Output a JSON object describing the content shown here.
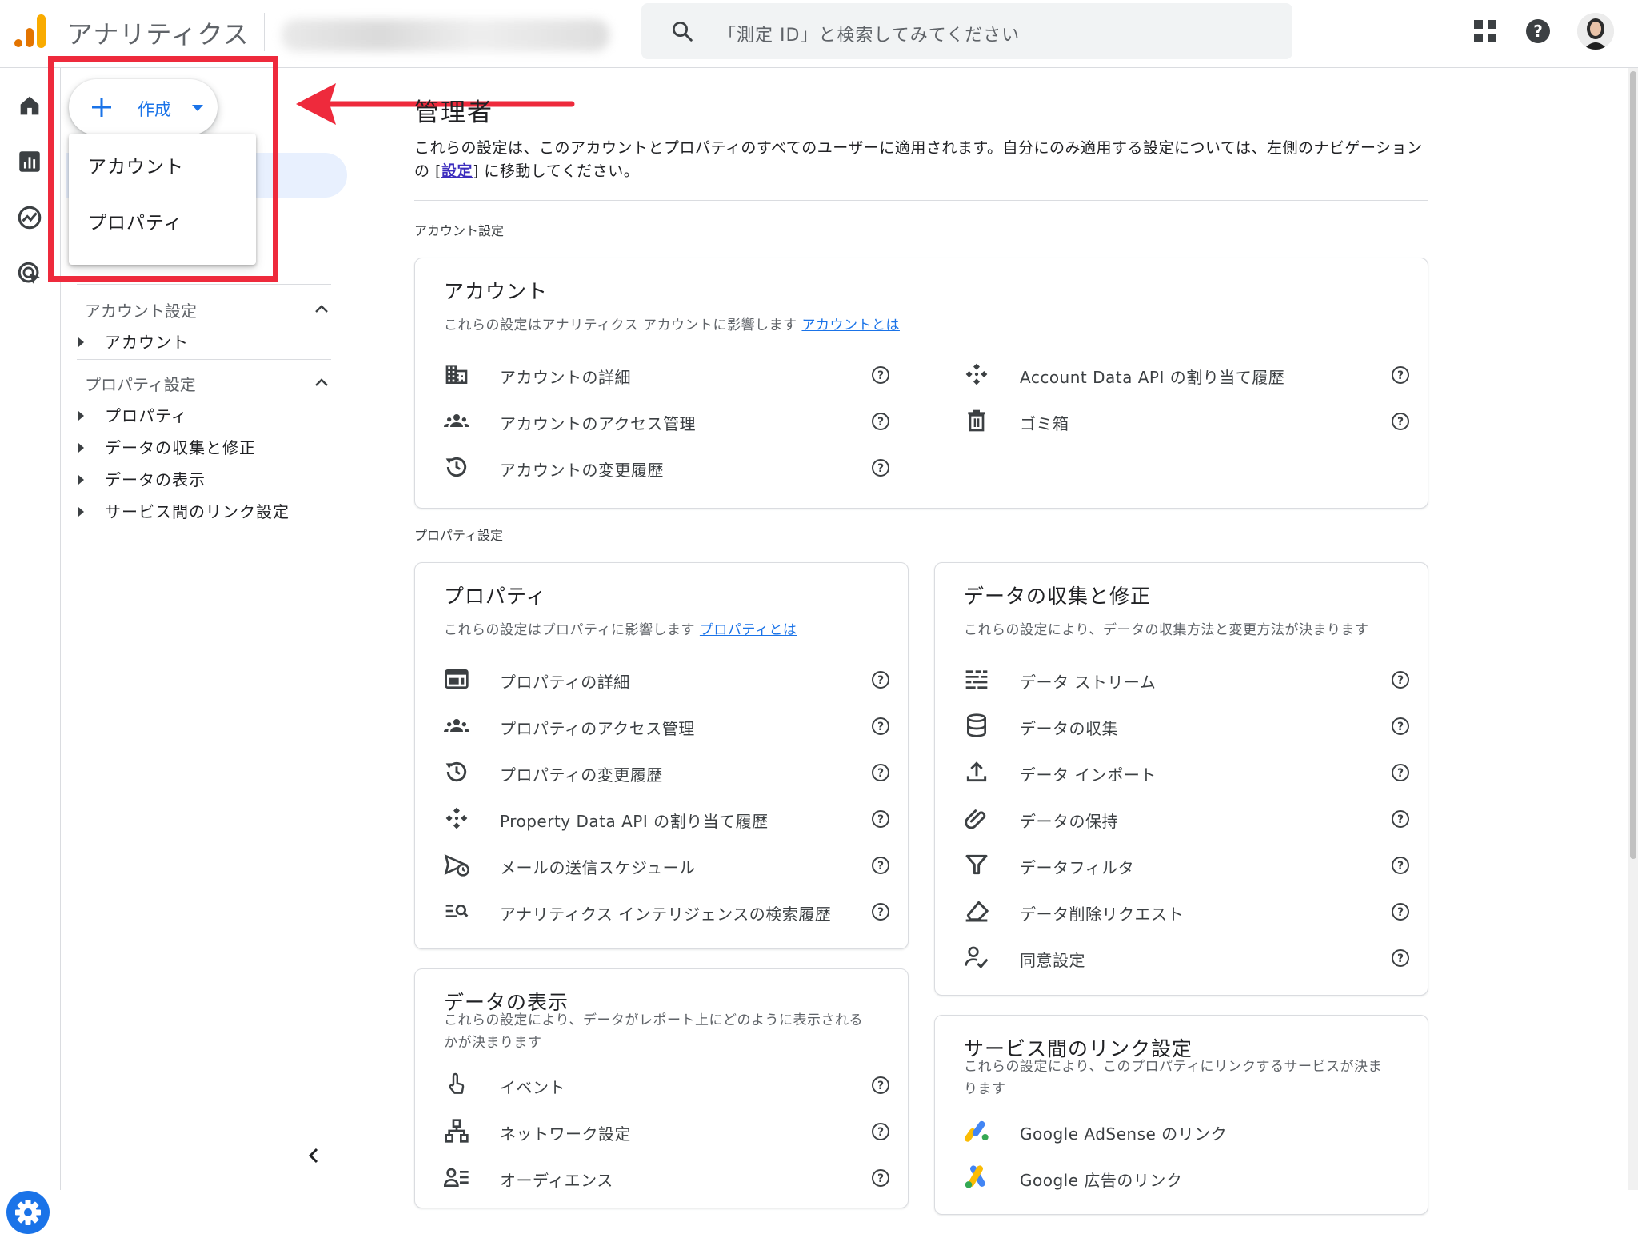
{
  "header": {
    "app_title": "アナリティクス",
    "search_placeholder": "「測定 ID」と検索してみてください"
  },
  "create": {
    "label": "作成",
    "menu_items": [
      "アカウント",
      "プロパティ"
    ]
  },
  "sidenav": {
    "sections": [
      {
        "title": "アカウント設定",
        "items": [
          "アカウント"
        ]
      },
      {
        "title": "プロパティ設定",
        "items": [
          "プロパティ",
          "データの収集と修正",
          "データの表示",
          "サービス間のリンク設定"
        ]
      }
    ]
  },
  "main": {
    "title": "管理者",
    "desc_before": "これらの設定は、このアカウントとプロパティのすべてのユーザーに適用されます。自分にのみ適用する設定については、左側のナビゲーションの [",
    "desc_link": "設定",
    "desc_after": "] に移動してください。",
    "account_section_label": "アカウント設定",
    "property_section_label": "プロパティ設定",
    "cards": {
      "account": {
        "title": "アカウント",
        "subtitle": "これらの設定はアナリティクス アカウントに影響します",
        "link": "アカウントとは",
        "left_rows": [
          {
            "label": "アカウントの詳細",
            "icon": "building-icon"
          },
          {
            "label": "アカウントのアクセス管理",
            "icon": "people-icon"
          },
          {
            "label": "アカウントの変更履歴",
            "icon": "history-icon"
          }
        ],
        "right_rows": [
          {
            "label": "Account Data API の割り当て履歴",
            "icon": "api-icon"
          },
          {
            "label": "ゴミ箱",
            "icon": "trash-icon"
          }
        ]
      },
      "property": {
        "title": "プロパティ",
        "subtitle": "これらの設定はプロパティに影響します",
        "link": "プロパティとは",
        "rows": [
          {
            "label": "プロパティの詳細",
            "icon": "web-icon"
          },
          {
            "label": "プロパティのアクセス管理",
            "icon": "people-icon"
          },
          {
            "label": "プロパティの変更履歴",
            "icon": "history-icon"
          },
          {
            "label": "Property Data API の割り当て履歴",
            "icon": "api-icon"
          },
          {
            "label": "メールの送信スケジュール",
            "icon": "scheduled-send-icon"
          },
          {
            "label": "アナリティクス インテリジェンスの検索履歴",
            "icon": "manage-search-icon"
          }
        ]
      },
      "data_collection": {
        "title": "データの収集と修正",
        "subtitle": "これらの設定により、データの収集方法と変更方法が決まります",
        "rows": [
          {
            "label": "データ ストリーム",
            "icon": "stream-icon"
          },
          {
            "label": "データの収集",
            "icon": "database-icon"
          },
          {
            "label": "データ インポート",
            "icon": "upload-icon"
          },
          {
            "label": "データの保持",
            "icon": "attach-icon"
          },
          {
            "label": "データフィルタ",
            "icon": "filter-icon"
          },
          {
            "label": "データ削除リクエスト",
            "icon": "eraser-icon"
          },
          {
            "label": "同意設定",
            "icon": "consent-icon"
          }
        ]
      },
      "data_display": {
        "title": "データの表示",
        "subtitle_1": "これらの設定により、データがレポート上にどのように表示される",
        "subtitle_2": "かが決まります",
        "rows": [
          {
            "label": "イベント",
            "icon": "touch-icon"
          },
          {
            "label": "ネットワーク設定",
            "icon": "network-icon"
          },
          {
            "label": "オーディエンス",
            "icon": "audience-icon"
          }
        ]
      },
      "links": {
        "title": "サービス間のリンク設定",
        "subtitle_1": "これらの設定により、このプロパティにリンクするサービスが決ま",
        "subtitle_2": "ります",
        "rows": [
          {
            "label": "Google AdSense のリンク",
            "icon": "adsense-icon"
          },
          {
            "label": "Google 広告のリンク",
            "icon": "google-ads-icon"
          }
        ]
      }
    }
  },
  "colors": {
    "accent": "#1a73e8",
    "annotation_red": "#ee2a3c",
    "logo_orange": "#f9ab00",
    "logo_dark_orange": "#e37400"
  }
}
